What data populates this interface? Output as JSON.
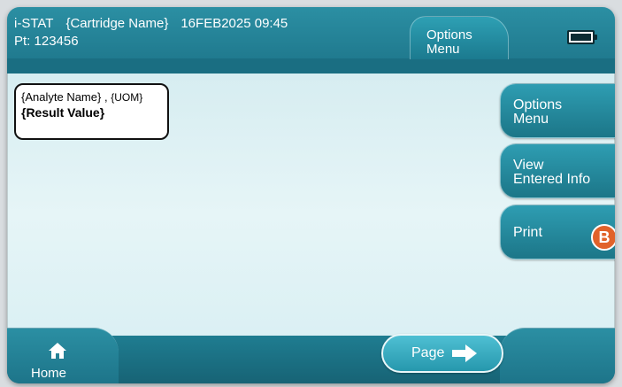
{
  "header": {
    "device": "i-STAT",
    "cartridge": "{Cartridge Name}",
    "datetime": "16FEB2025 09:45",
    "patient": "Pt: 123456",
    "tab": {
      "line1": "Options",
      "line2": "Menu"
    },
    "battery_icon": "battery-full-icon"
  },
  "result": {
    "analyte": "{Analyte Name}",
    "separator": " , ",
    "uom": "{UOM}",
    "value": "{Result Value}"
  },
  "side_buttons": {
    "options": {
      "line1": "Options",
      "line2": "Menu"
    },
    "view": {
      "line1": "View",
      "line2": "Entered Info"
    },
    "print": {
      "label": "Print",
      "badge": "B"
    }
  },
  "footer": {
    "home_label": "Home",
    "home_icon": "home-icon",
    "page_label": "Page",
    "page_icon": "arrow-right-icon"
  },
  "colors": {
    "header": "#1d7489",
    "button": "#2e9db2",
    "page_button": "#4fc0d3",
    "badge": "#e1622a",
    "background": "#e6f5f7"
  }
}
